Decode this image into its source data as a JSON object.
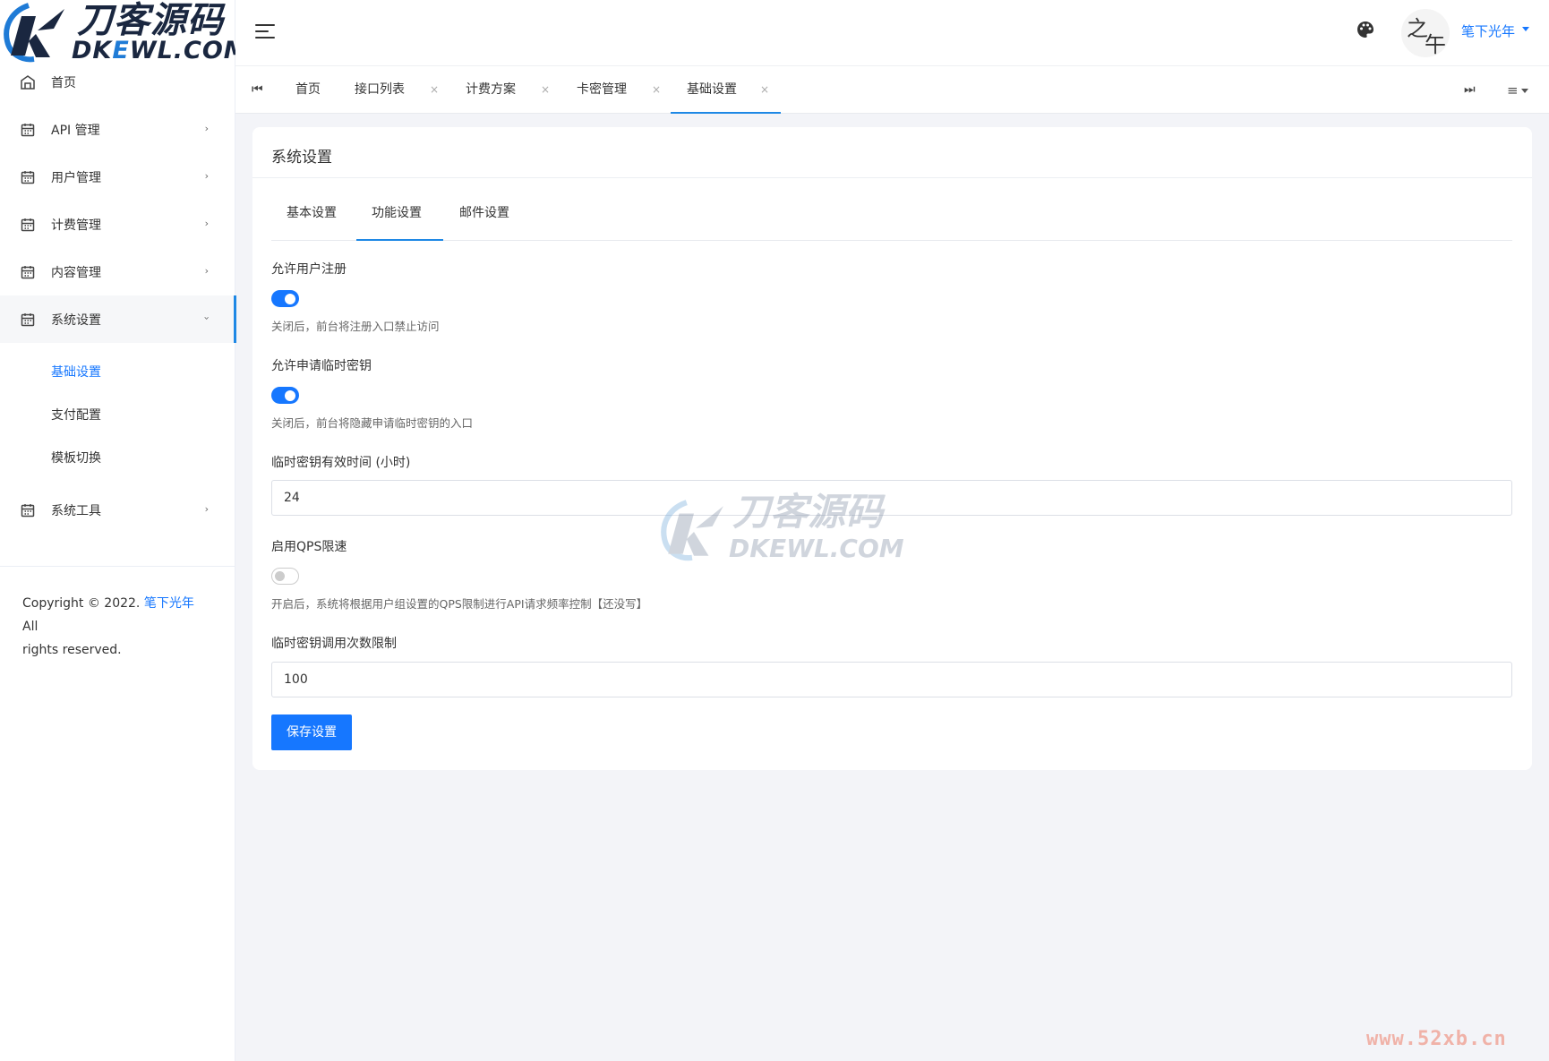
{
  "brand": {
    "logo_cn": "刀客源码",
    "logo_en_prefix": "DK",
    "logo_en_mid": "E",
    "logo_en_suffix": "WL.COM"
  },
  "sidebar": {
    "items": [
      {
        "label": "首页",
        "icon": "home-icon"
      },
      {
        "label": "API 管理",
        "icon": "calendar-icon"
      },
      {
        "label": "用户管理",
        "icon": "calendar-icon"
      },
      {
        "label": "计费管理",
        "icon": "calendar-icon"
      },
      {
        "label": "内容管理",
        "icon": "calendar-icon"
      },
      {
        "label": "系统设置",
        "icon": "calendar-icon"
      },
      {
        "label": "系统工具",
        "icon": "calendar-icon"
      }
    ],
    "submenu": [
      "基础设置",
      "支付配置",
      "模板切换"
    ],
    "footer": {
      "copyright": "Copyright © 2022. ",
      "link": "笔下光年",
      "rest1": " All",
      "rest2": "rights reserved."
    }
  },
  "header": {
    "user_name": "笔下光年",
    "avatar_chars": [
      "之",
      "午"
    ]
  },
  "tabs": [
    "首页",
    "接口列表",
    "计费方案",
    "卡密管理",
    "基础设置"
  ],
  "card": {
    "title": "系统设置",
    "subtabs": [
      "基本设置",
      "功能设置",
      "邮件设置"
    ],
    "fields": {
      "allow_register": {
        "label": "允许用户注册",
        "help": "关闭后，前台将注册入口禁止访问",
        "on": true
      },
      "allow_temp_key": {
        "label": "允许申请临时密钥",
        "help": "关闭后，前台将隐藏申请临时密钥的入口",
        "on": true
      },
      "temp_key_hours": {
        "label": "临时密钥有效时间 (小时)",
        "value": "24"
      },
      "qps": {
        "label": "启用QPS限速",
        "help": "开启后，系统将根据用户组设置的QPS限制进行API请求频率控制【还没写】",
        "on": false
      },
      "temp_key_limit": {
        "label": "临时密钥调用次数限制",
        "value": "100"
      }
    },
    "save_label": "保存设置"
  },
  "watermark": {
    "cn": "刀客源码",
    "en": "DKEWL.COM",
    "site": "www.52xb.cn"
  },
  "colors": {
    "accent": "#1677ff"
  }
}
